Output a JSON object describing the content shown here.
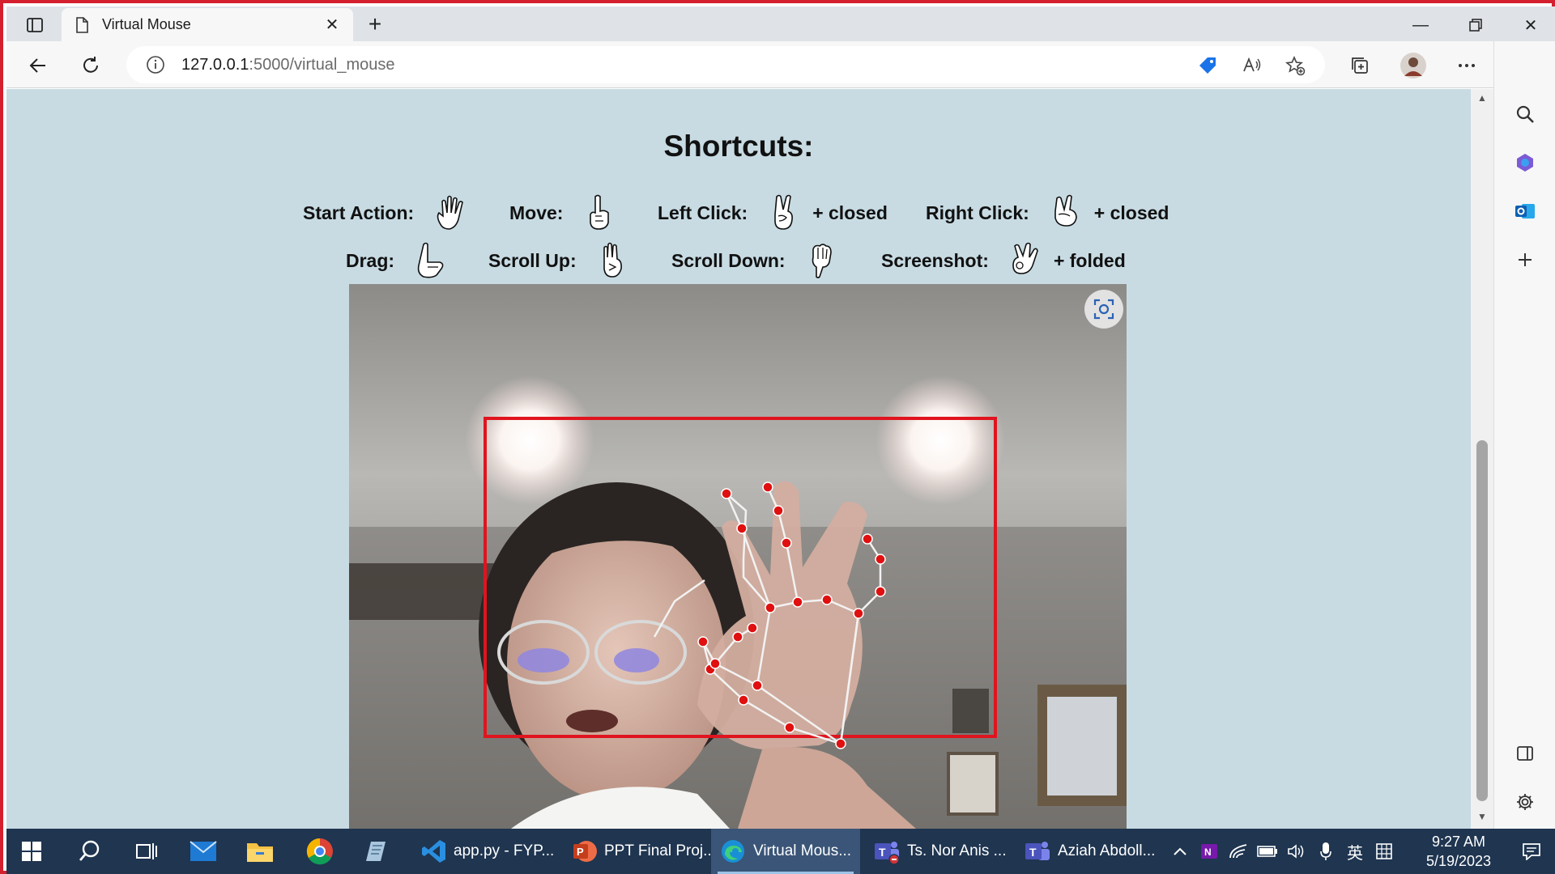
{
  "browser": {
    "tab_title": "Virtual Mouse",
    "url_host": "127.0.0.1",
    "url_rest": ":5000/virtual_mouse"
  },
  "page": {
    "heading": "Shortcuts:",
    "shortcuts_row1": [
      {
        "label": "Start Action:",
        "icon": "open-hand-icon",
        "suffix": ""
      },
      {
        "label": "Move:",
        "icon": "index-finger-icon",
        "suffix": ""
      },
      {
        "label": "Left Click:",
        "icon": "victory-hand-icon",
        "suffix": "+ closed"
      },
      {
        "label": "Right Click:",
        "icon": "victory-hand-icon",
        "suffix": "+ closed"
      }
    ],
    "shortcuts_row2": [
      {
        "label": "Drag:",
        "icon": "thumb-index-hand-icon",
        "suffix": ""
      },
      {
        "label": "Scroll Up:",
        "icon": "three-fingers-up-icon",
        "suffix": ""
      },
      {
        "label": "Scroll Down:",
        "icon": "three-fingers-down-icon",
        "suffix": ""
      },
      {
        "label": "Screenshot:",
        "icon": "ok-hand-icon",
        "suffix": "+ folded"
      }
    ]
  },
  "taskbar": {
    "items": [
      {
        "label": "app.py - FYP..."
      },
      {
        "label": "PPT Final Proj..."
      },
      {
        "label": "Virtual Mous..."
      },
      {
        "label": "Ts. Nor Anis ..."
      },
      {
        "label": "Aziah Abdoll..."
      }
    ],
    "ime": "英",
    "time": "9:27 AM",
    "date": "5/19/2023"
  },
  "colors": {
    "page_bg": "#c8dbe3",
    "tracking_box": "#e0141e",
    "landmark": "#e01010",
    "taskbar": "#1f3550"
  }
}
